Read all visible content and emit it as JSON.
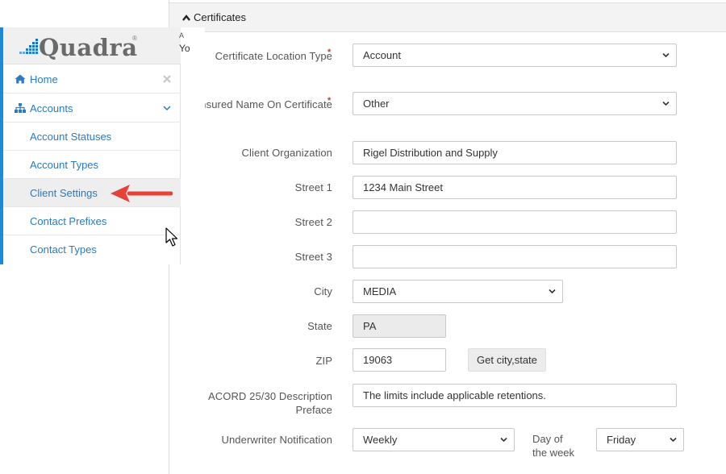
{
  "panel": {
    "title": "Certificates"
  },
  "form": {
    "certificate_location_type": {
      "label": "Certificate Location Type",
      "value": "Account",
      "required": true
    },
    "insured_name": {
      "label": "Insured Name On Certificate",
      "value": "Other",
      "required": true
    },
    "client_organization": {
      "label": "Client Organization",
      "value": "Rigel Distribution and Supply"
    },
    "street1": {
      "label": "Street 1",
      "value": "1234 Main Street"
    },
    "street2": {
      "label": "Street 2",
      "value": ""
    },
    "street3": {
      "label": "Street 3",
      "value": ""
    },
    "city": {
      "label": "City",
      "value": "MEDIA"
    },
    "state": {
      "label": "State",
      "value": "PA"
    },
    "zip": {
      "label": "ZIP",
      "value": "19063",
      "button": "Get city,state"
    },
    "acord": {
      "label_line1": "ACORD 25/30 Description",
      "label_line2": "Preface",
      "value": "The limits include applicable retentions."
    },
    "underwriter": {
      "label": "Underwriter Notification",
      "value": "Weekly"
    },
    "day_of_week": {
      "label_line1": "Day of",
      "label_line2": "the week",
      "value": "Friday"
    },
    "required_mark": "*"
  },
  "sidebar": {
    "logo": "Quadra",
    "logo_mark": "®",
    "peek_top": "A",
    "peek_bottom": "Yo",
    "items": [
      {
        "label": "Home",
        "icon": "home-icon"
      },
      {
        "label": "Accounts",
        "icon": "sitemap-icon"
      },
      {
        "label": "Account Statuses"
      },
      {
        "label": "Account Types"
      },
      {
        "label": "Client Settings"
      },
      {
        "label": "Contact Prefixes"
      },
      {
        "label": "Contact Types"
      }
    ]
  },
  "colors": {
    "accent": "#1e8ad6",
    "link": "#2a7bbf",
    "required": "#a94442",
    "arrow": "#e8413a"
  }
}
